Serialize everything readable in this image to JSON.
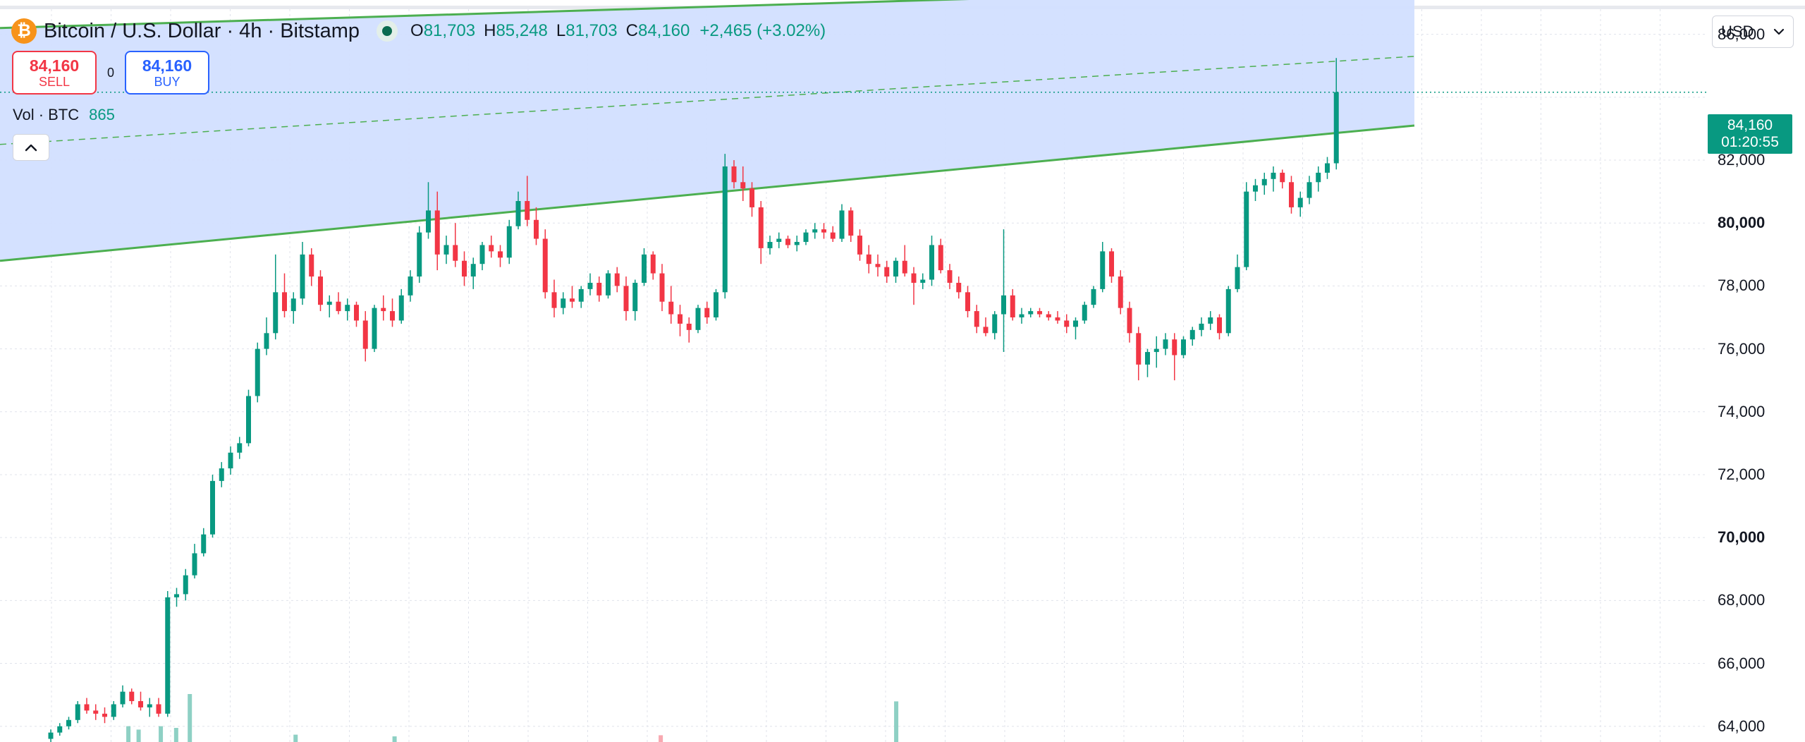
{
  "header": {
    "symbol_title": "Bitcoin / U.S. Dollar · 4h · Bitstamp",
    "icon": "bitcoin-icon",
    "ohlc": {
      "open_label": "O",
      "open": "81,703",
      "high_label": "H",
      "high": "85,248",
      "low_label": "L",
      "low": "81,703",
      "close_label": "C",
      "close": "84,160",
      "change": "+2,465 (+3.02%)"
    }
  },
  "trade": {
    "sell_price": "84,160",
    "sell_label": "SELL",
    "spread": "0",
    "buy_price": "84,160",
    "buy_label": "BUY"
  },
  "volume": {
    "label": "Vol · BTC",
    "value": "865"
  },
  "currency": {
    "selected": "USD"
  },
  "price_tag": {
    "price": "84,160",
    "countdown": "01:20:55"
  },
  "colors": {
    "up": "#089981",
    "down": "#f23645",
    "channel_line": "#4caf50",
    "channel_fill": "#d2dfff",
    "grid": "#e0e3eb",
    "volume_up": "#8ed0c4",
    "volume_down": "#f8a8b0"
  },
  "chart_data": {
    "type": "candlestick",
    "y_axis": {
      "position": "right",
      "range": [
        63500,
        86800
      ],
      "ticks": [
        {
          "value": 86000,
          "label": "86,000",
          "bold": false
        },
        {
          "value": 84000,
          "label": "",
          "bold": false
        },
        {
          "value": 82000,
          "label": "82,000",
          "bold": false
        },
        {
          "value": 80000,
          "label": "80,000",
          "bold": true
        },
        {
          "value": 78000,
          "label": "78,000",
          "bold": false
        },
        {
          "value": 76000,
          "label": "76,000",
          "bold": false
        },
        {
          "value": 74000,
          "label": "74,000",
          "bold": false
        },
        {
          "value": 72000,
          "label": "72,000",
          "bold": false
        },
        {
          "value": 70000,
          "label": "70,000",
          "bold": true
        },
        {
          "value": 68000,
          "label": "68,000",
          "bold": false
        },
        {
          "value": 66000,
          "label": "66,000",
          "bold": false
        },
        {
          "value": 64000,
          "label": "64,000",
          "bold": false
        }
      ]
    },
    "grid": true,
    "last_price": 84160,
    "channel": {
      "upper_start": 86200,
      "upper_end": 87550,
      "lower_start": 78800,
      "lower_end": 83100,
      "mid_start": 82500,
      "mid_end": 85300
    },
    "volume_bars": [
      {
        "slot": 0.074,
        "fraction": 0.28,
        "dir": "up"
      },
      {
        "slot": 0.08,
        "fraction": 0.22,
        "dir": "up"
      },
      {
        "slot": 0.093,
        "fraction": 0.28,
        "dir": "up"
      },
      {
        "slot": 0.102,
        "fraction": 0.25,
        "dir": "up"
      },
      {
        "slot": 0.11,
        "fraction": 0.85,
        "dir": "up"
      },
      {
        "slot": 0.172,
        "fraction": 0.13,
        "dir": "up"
      },
      {
        "slot": 0.23,
        "fraction": 0.1,
        "dir": "up"
      },
      {
        "slot": 0.386,
        "fraction": 0.12,
        "dir": "down"
      },
      {
        "slot": 0.524,
        "fraction": 0.72,
        "dir": "up"
      }
    ],
    "candles": [
      [
        63600,
        63900,
        63500,
        63800
      ],
      [
        63800,
        64100,
        63700,
        64000
      ],
      [
        64000,
        64300,
        63900,
        64200
      ],
      [
        64200,
        64800,
        64100,
        64700
      ],
      [
        64700,
        64900,
        64400,
        64500
      ],
      [
        64500,
        64700,
        64200,
        64400
      ],
      [
        64400,
        64600,
        64100,
        64300
      ],
      [
        64300,
        64800,
        64200,
        64700
      ],
      [
        64700,
        65300,
        64600,
        65100
      ],
      [
        65100,
        65200,
        64700,
        64800
      ],
      [
        64800,
        65100,
        64500,
        64600
      ],
      [
        64600,
        64900,
        64300,
        64700
      ],
      [
        64700,
        64900,
        64300,
        64400
      ],
      [
        64400,
        68300,
        64300,
        68100
      ],
      [
        68100,
        68400,
        67800,
        68200
      ],
      [
        68200,
        69000,
        68000,
        68800
      ],
      [
        68800,
        69800,
        68700,
        69500
      ],
      [
        69500,
        70300,
        69400,
        70100
      ],
      [
        70100,
        72000,
        70000,
        71800
      ],
      [
        71800,
        72400,
        71600,
        72200
      ],
      [
        72200,
        72900,
        72000,
        72700
      ],
      [
        72700,
        73200,
        72500,
        73000
      ],
      [
        73000,
        74700,
        72900,
        74500
      ],
      [
        74500,
        76200,
        74300,
        76000
      ],
      [
        76000,
        77000,
        75800,
        76500
      ],
      [
        76500,
        79000,
        76300,
        77800
      ],
      [
        77800,
        78400,
        77000,
        77200
      ],
      [
        77200,
        77800,
        76800,
        77600
      ],
      [
        77600,
        79400,
        77400,
        79000
      ],
      [
        79000,
        79200,
        78000,
        78300
      ],
      [
        78300,
        78500,
        77200,
        77400
      ],
      [
        77400,
        77700,
        77000,
        77500
      ],
      [
        77500,
        77800,
        77100,
        77200
      ],
      [
        77200,
        77600,
        76900,
        77400
      ],
      [
        77400,
        77500,
        76700,
        76900
      ],
      [
        76900,
        77200,
        75600,
        76000
      ],
      [
        76000,
        77400,
        75900,
        77300
      ],
      [
        77300,
        77700,
        76900,
        77200
      ],
      [
        77200,
        77600,
        76700,
        76900
      ],
      [
        76900,
        77900,
        76800,
        77700
      ],
      [
        77700,
        78500,
        77500,
        78300
      ],
      [
        78300,
        79900,
        78100,
        79700
      ],
      [
        79700,
        81300,
        79500,
        80400
      ],
      [
        80400,
        81000,
        78500,
        79000
      ],
      [
        79000,
        79600,
        78700,
        79300
      ],
      [
        79300,
        80000,
        78600,
        78800
      ],
      [
        78800,
        79100,
        78000,
        78300
      ],
      [
        78300,
        78900,
        77900,
        78700
      ],
      [
        78700,
        79400,
        78500,
        79300
      ],
      [
        79300,
        79600,
        78900,
        79100
      ],
      [
        79100,
        79300,
        78600,
        78900
      ],
      [
        78900,
        80100,
        78700,
        79900
      ],
      [
        79900,
        81000,
        79800,
        80700
      ],
      [
        80700,
        81500,
        79900,
        80100
      ],
      [
        80100,
        80500,
        79300,
        79500
      ],
      [
        79500,
        79800,
        77600,
        77800
      ],
      [
        77800,
        78200,
        77000,
        77300
      ],
      [
        77300,
        77800,
        77100,
        77600
      ],
      [
        77600,
        78000,
        77300,
        77500
      ],
      [
        77500,
        78000,
        77300,
        77900
      ],
      [
        77900,
        78400,
        77700,
        78100
      ],
      [
        78100,
        78300,
        77500,
        77700
      ],
      [
        77700,
        78500,
        77600,
        78400
      ],
      [
        78400,
        78600,
        77800,
        78000
      ],
      [
        78000,
        78300,
        76900,
        77200
      ],
      [
        77200,
        78200,
        76900,
        78100
      ],
      [
        78100,
        79200,
        78000,
        79000
      ],
      [
        79000,
        79100,
        78200,
        78400
      ],
      [
        78400,
        78700,
        77200,
        77500
      ],
      [
        77500,
        78000,
        76800,
        77100
      ],
      [
        77100,
        77400,
        76400,
        76800
      ],
      [
        76800,
        77000,
        76200,
        76600
      ],
      [
        76600,
        77400,
        76500,
        77300
      ],
      [
        77300,
        77500,
        76800,
        77000
      ],
      [
        77000,
        77900,
        76900,
        77800
      ],
      [
        77800,
        82200,
        77600,
        81800
      ],
      [
        81800,
        82000,
        81100,
        81300
      ],
      [
        81300,
        81800,
        80700,
        81100
      ],
      [
        81100,
        81300,
        80200,
        80500
      ],
      [
        80500,
        80700,
        78700,
        79200
      ],
      [
        79200,
        79600,
        79000,
        79400
      ],
      [
        79400,
        79700,
        79200,
        79500
      ],
      [
        79500,
        79600,
        79200,
        79300
      ],
      [
        79300,
        79600,
        79100,
        79400
      ],
      [
        79400,
        79800,
        79300,
        79700
      ],
      [
        79700,
        80000,
        79500,
        79800
      ],
      [
        79800,
        80000,
        79500,
        79700
      ],
      [
        79700,
        79900,
        79400,
        79500
      ],
      [
        79500,
        80600,
        79400,
        80400
      ],
      [
        80400,
        80500,
        79400,
        79600
      ],
      [
        79600,
        79800,
        78800,
        79000
      ],
      [
        79000,
        79300,
        78400,
        78700
      ],
      [
        78700,
        79000,
        78300,
        78600
      ],
      [
        78600,
        78800,
        78100,
        78300
      ],
      [
        78300,
        78900,
        78100,
        78800
      ],
      [
        78800,
        79300,
        78300,
        78400
      ],
      [
        78400,
        78600,
        77400,
        78100
      ],
      [
        78100,
        78400,
        77900,
        78200
      ],
      [
        78200,
        79600,
        78000,
        79300
      ],
      [
        79300,
        79500,
        78400,
        78500
      ],
      [
        78500,
        78700,
        77900,
        78100
      ],
      [
        78100,
        78300,
        77600,
        77800
      ],
      [
        77800,
        78000,
        77000,
        77200
      ],
      [
        77200,
        77400,
        76500,
        76700
      ],
      [
        76700,
        77000,
        76400,
        76500
      ],
      [
        76500,
        77200,
        76300,
        77100
      ],
      [
        77100,
        79800,
        75900,
        77700
      ],
      [
        77700,
        77900,
        76900,
        77000
      ],
      [
        77000,
        77300,
        76800,
        77100
      ],
      [
        77100,
        77300,
        77000,
        77200
      ],
      [
        77200,
        77300,
        77000,
        77100
      ],
      [
        77100,
        77200,
        76900,
        77000
      ],
      [
        77000,
        77200,
        76800,
        76900
      ],
      [
        76900,
        77100,
        76500,
        76700
      ],
      [
        76700,
        77000,
        76300,
        76900
      ],
      [
        76900,
        77500,
        76800,
        77400
      ],
      [
        77400,
        78000,
        77300,
        77900
      ],
      [
        77900,
        79400,
        77800,
        79100
      ],
      [
        79100,
        79200,
        78100,
        78300
      ],
      [
        78300,
        78500,
        77100,
        77300
      ],
      [
        77300,
        77500,
        76200,
        76500
      ],
      [
        76500,
        76700,
        75000,
        75500
      ],
      [
        75500,
        76000,
        75100,
        75900
      ],
      [
        75900,
        76400,
        75400,
        76000
      ],
      [
        76000,
        76500,
        75800,
        76300
      ],
      [
        76300,
        76500,
        75000,
        75800
      ],
      [
        75800,
        76400,
        75700,
        76300
      ],
      [
        76300,
        76700,
        76100,
        76600
      ],
      [
        76600,
        77000,
        76400,
        76800
      ],
      [
        76800,
        77200,
        76600,
        77000
      ],
      [
        77000,
        77100,
        76300,
        76500
      ],
      [
        76500,
        78000,
        76400,
        77900
      ],
      [
        77900,
        79000,
        77800,
        78600
      ],
      [
        78600,
        81300,
        78500,
        81000
      ],
      [
        81000,
        81400,
        80700,
        81200
      ],
      [
        81200,
        81600,
        80900,
        81400
      ],
      [
        81400,
        81800,
        81000,
        81600
      ],
      [
        81600,
        81700,
        81100,
        81300
      ],
      [
        81300,
        81500,
        80300,
        80500
      ],
      [
        80500,
        81000,
        80200,
        80800
      ],
      [
        80800,
        81500,
        80600,
        81300
      ],
      [
        81300,
        81800,
        81000,
        81600
      ],
      [
        81600,
        82100,
        81400,
        81900
      ],
      [
        81900,
        85248,
        81703,
        84160
      ]
    ]
  }
}
